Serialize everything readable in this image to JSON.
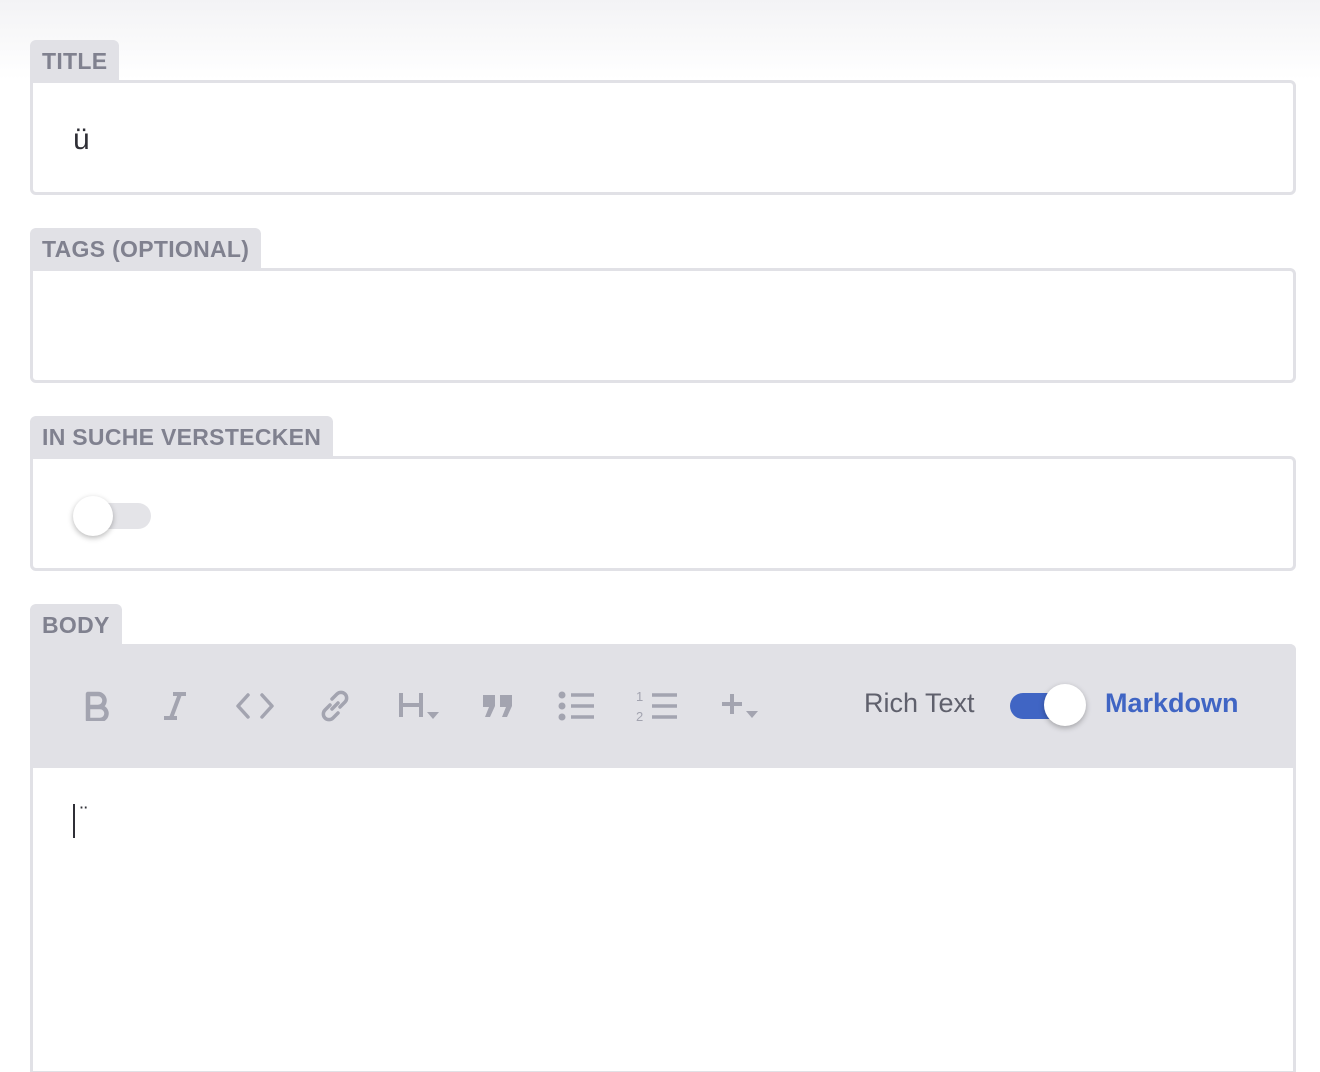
{
  "fields": {
    "title": {
      "label": "TITLE",
      "value": "ü"
    },
    "tags": {
      "label": "TAGS (OPTIONAL)",
      "value": ""
    },
    "hide_in_search": {
      "label": "IN SUCHE VERSTECKEN",
      "enabled": false
    },
    "body": {
      "label": "BODY",
      "content": "¨"
    }
  },
  "toolbar": {
    "buttons": [
      {
        "name": "bold",
        "icon": "bold-icon"
      },
      {
        "name": "italic",
        "icon": "italic-icon"
      },
      {
        "name": "code",
        "icon": "code-icon"
      },
      {
        "name": "link",
        "icon": "link-icon"
      },
      {
        "name": "heading",
        "icon": "heading-dropdown-icon"
      },
      {
        "name": "quote",
        "icon": "quote-icon"
      },
      {
        "name": "bullet-list",
        "icon": "bullet-list-icon"
      },
      {
        "name": "ordered-list",
        "icon": "ordered-list-icon"
      },
      {
        "name": "insert",
        "icon": "plus-dropdown-icon"
      }
    ],
    "mode": {
      "rich_text_label": "Rich Text",
      "markdown_label": "Markdown",
      "markdown_enabled": true
    }
  },
  "colors": {
    "accent": "#4065c4",
    "label_bg": "#e1e1e6",
    "label_text": "#80818f",
    "icon": "#a3a4b0"
  }
}
